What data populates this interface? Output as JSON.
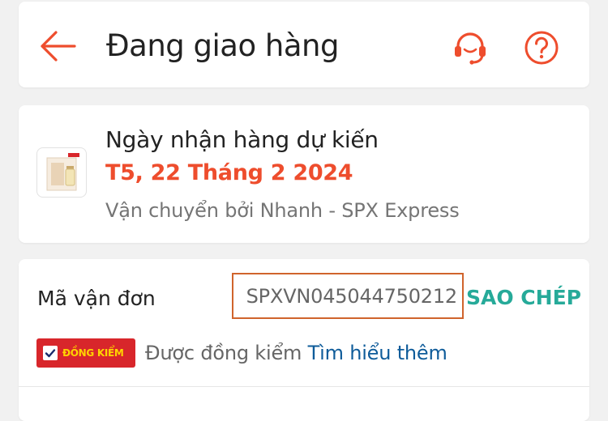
{
  "header": {
    "title": "Đang giao hàng",
    "back_icon": "arrow-left-icon",
    "support_icon": "headset-icon",
    "help_icon": "question-circle-icon"
  },
  "delivery": {
    "eta_label": "Ngày nhận hàng dự kiến",
    "eta_date": "T5, 22 Tháng 2 2024",
    "carrier": "Vận chuyển bởi Nhanh - SPX Express"
  },
  "tracking": {
    "label": "Mã vận đơn",
    "code": "SPXVN045044750212",
    "copy_label": "SAO CHÉP",
    "badge_text": "ĐỒNG KIỂM",
    "badge_desc": "Được đồng kiểm",
    "learn_more": "Tìm hiểu thêm"
  },
  "colors": {
    "accent": "#ee4d2d",
    "copy": "#26aa99",
    "link": "#0f5c9a",
    "badge": "#d8262b",
    "highlight_box": "#d0642c"
  }
}
